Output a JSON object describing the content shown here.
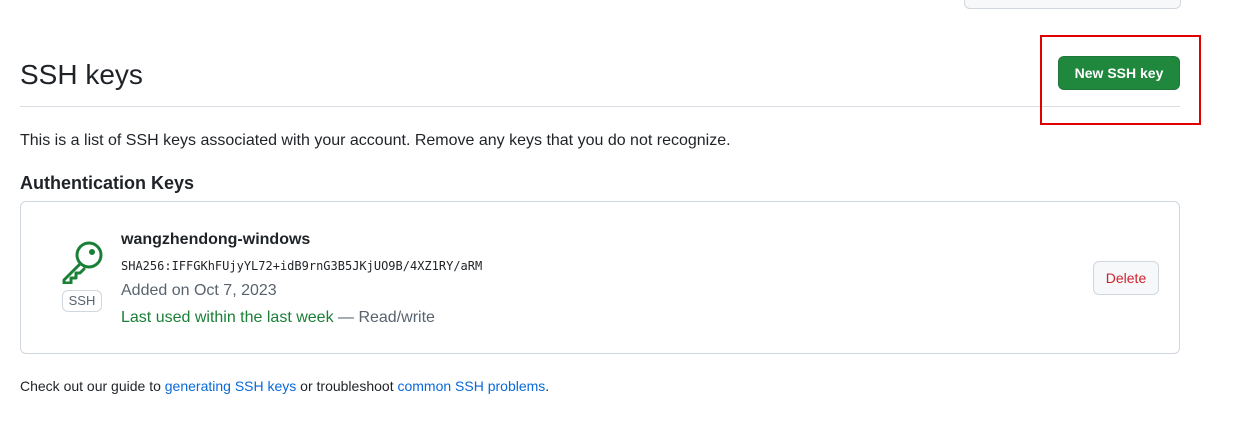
{
  "section": {
    "title": "SSH keys",
    "new_key_label": "New SSH key",
    "intro": "This is a list of SSH keys associated with your account. Remove any keys that you do not recognize.",
    "subheading": "Authentication Keys"
  },
  "key": {
    "icon": "key-icon",
    "type_badge": "SSH",
    "title": "wangzhendong-windows",
    "fingerprint": "SHA256:IFFGKhFUjyYL72+idB9rnG3B5JKjUO9B/4XZ1RY/aRM",
    "added": "Added on Oct 7, 2023",
    "last_used": "Last used within the last week",
    "access": " — Read/write",
    "delete_label": "Delete"
  },
  "footer": {
    "prefix": "Check out our guide to ",
    "link1": "generating SSH keys",
    "middle": " or troubleshoot ",
    "link2": "common SSH problems",
    "suffix": "."
  },
  "colors": {
    "primary_button": "#1f883d",
    "danger_text": "#cf222e",
    "link": "#0969da",
    "success_text": "#1a7f37",
    "highlight_annotation": "#e00000"
  }
}
